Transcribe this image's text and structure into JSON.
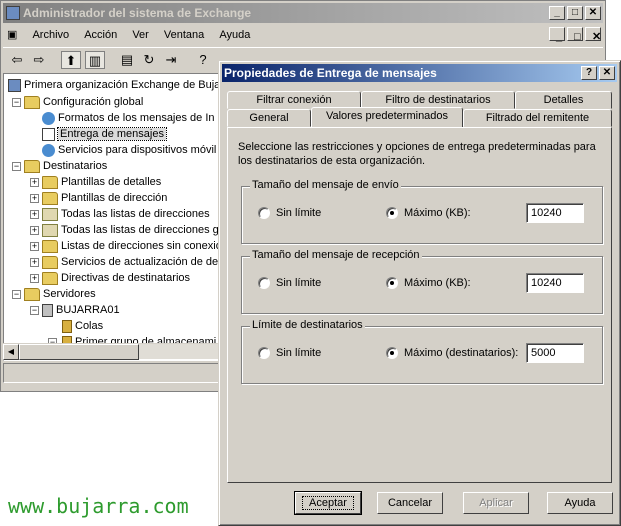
{
  "mmc": {
    "title": "Administrador del sistema de Exchange",
    "menu": [
      {
        "label": "Archivo"
      },
      {
        "label": "Acción"
      },
      {
        "label": "Ver"
      },
      {
        "label": "Ventana"
      },
      {
        "label": "Ayuda"
      }
    ],
    "window_controls": {
      "minimize": "_",
      "restore": "□",
      "close": "✕"
    },
    "tree": {
      "root": "Primera organización Exchange de Bujar",
      "config": "Configuración global",
      "formats": "Formatos de los mensajes de In",
      "delivery": "Entrega de mensajes",
      "mobile": "Servicios para dispositivos móvil",
      "recipients": "Destinatarios",
      "details": "Plantillas de detalles",
      "address_tpl": "Plantillas de dirección",
      "all_lists": "Todas las listas de direcciones",
      "all_lists_gl": "Todas las listas de direcciones gl",
      "offline_lists": "Listas de direcciones sin conexió",
      "update_services": "Servicios de actualización de des",
      "policies": "Directivas de destinatarios",
      "servers": "Servidores",
      "server1": "BUJARRA01",
      "queues": "Colas",
      "storage_group": "Primer grupo de almacenami"
    }
  },
  "dialog": {
    "title": "Propiedades de Entrega de mensajes",
    "help_btn": "?",
    "close_btn": "✕",
    "tabs_row1": [
      "Filtrar conexión",
      "Filtro de destinatarios",
      "Detalles"
    ],
    "tabs_row2": [
      "General",
      "Valores predeterminados",
      "Filtrado del remitente"
    ],
    "description": "Seleccione las restricciones y opciones de entrega predeterminadas para los destinatarios de esta organización.",
    "groups": [
      {
        "label": "Tamaño del mensaje de envío",
        "unlimited": "Sin límite",
        "max_label": "Máximo (KB):",
        "value": "10240"
      },
      {
        "label": "Tamaño del mensaje de recepción",
        "unlimited": "Sin límite",
        "max_label": "Máximo (KB):",
        "value": "10240"
      },
      {
        "label": "Límite de destinatarios",
        "unlimited": "Sin límite",
        "max_label": "Máximo (destinatarios):",
        "value": "5000"
      }
    ],
    "buttons": {
      "ok": "Aceptar",
      "cancel": "Cancelar",
      "apply": "Aplicar",
      "help": "Ayuda"
    }
  },
  "watermark": "www.bujarra.com",
  "colors": {
    "title_active": "#0a246a",
    "title_inactive": "#808080",
    "face": "#d4d0c8",
    "watermark": "#2e9b2e"
  }
}
